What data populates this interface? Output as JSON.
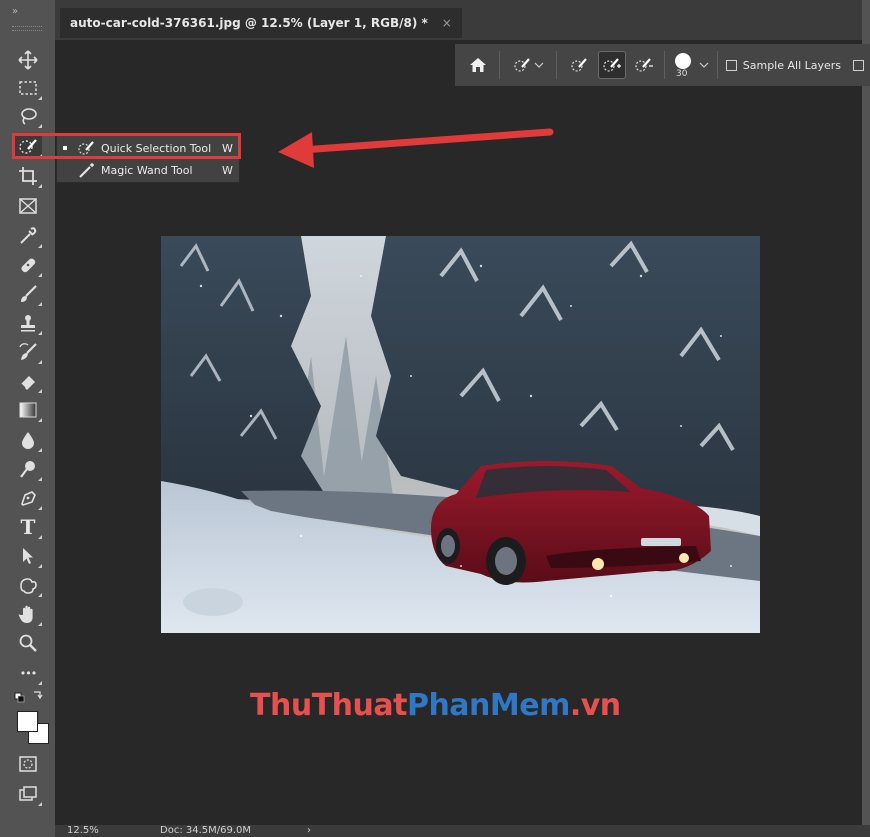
{
  "document_tab": {
    "title": "auto-car-cold-376361.jpg @ 12.5% (Layer 1, RGB/8) *",
    "close": "×"
  },
  "toolbar": {
    "collapse_glyph": "»",
    "tools": [
      {
        "name": "move-tool",
        "icon": "move-icon"
      },
      {
        "name": "rectangular-marquee-tool",
        "icon": "marquee-icon"
      },
      {
        "name": "lasso-tool",
        "icon": "lasso-icon"
      },
      {
        "name": "quick-selection-tool",
        "icon": "quick-selection-icon"
      },
      {
        "name": "crop-tool",
        "icon": "crop-icon"
      },
      {
        "name": "frame-tool",
        "icon": "frame-icon"
      },
      {
        "name": "eyedropper-tool",
        "icon": "eyedropper-icon"
      },
      {
        "name": "spot-healing-tool",
        "icon": "bandage-icon"
      },
      {
        "name": "brush-tool",
        "icon": "brush-icon"
      },
      {
        "name": "clone-stamp-tool",
        "icon": "stamp-icon"
      },
      {
        "name": "history-brush-tool",
        "icon": "history-brush-icon"
      },
      {
        "name": "eraser-tool",
        "icon": "eraser-icon"
      },
      {
        "name": "gradient-tool",
        "icon": "gradient-icon"
      },
      {
        "name": "blur-tool",
        "icon": "drop-icon"
      },
      {
        "name": "dodge-tool",
        "icon": "dodge-icon"
      },
      {
        "name": "pen-tool",
        "icon": "pen-icon"
      },
      {
        "name": "type-tool",
        "icon": "type-icon"
      },
      {
        "name": "path-selection-tool",
        "icon": "arrow-cursor-icon"
      },
      {
        "name": "custom-shape-tool",
        "icon": "shape-icon"
      },
      {
        "name": "hand-tool",
        "icon": "hand-icon"
      },
      {
        "name": "zoom-tool",
        "icon": "zoom-icon"
      },
      {
        "name": "edit-toolbar",
        "icon": "more-icon"
      }
    ],
    "type_tool_glyph": "T",
    "more_glyph": "•••"
  },
  "options_bar": {
    "home_icon": "home-icon",
    "brush_size": "30",
    "sample_all_layers_label": "Sample All Layers",
    "sample_all_layers_checked": false
  },
  "flyout": {
    "items": [
      {
        "label": "Quick Selection Tool",
        "shortcut": "W",
        "selected": true,
        "icon": "quick-selection-icon"
      },
      {
        "label": "Magic Wand Tool",
        "shortcut": "W",
        "selected": false,
        "icon": "magic-wand-icon"
      }
    ]
  },
  "watermark": {
    "part1": "Thu",
    "part2": "Thuat",
    "part3": "PhanMem",
    "part4": ".vn"
  },
  "status_bar": {
    "zoom": "12.5%",
    "doc": "Doc: 34.5M/69.0M",
    "arrow": "›"
  },
  "colors": {
    "highlight": "#e03a3a",
    "watermark_red": "#e85050",
    "watermark_blue": "#2f78c6"
  }
}
